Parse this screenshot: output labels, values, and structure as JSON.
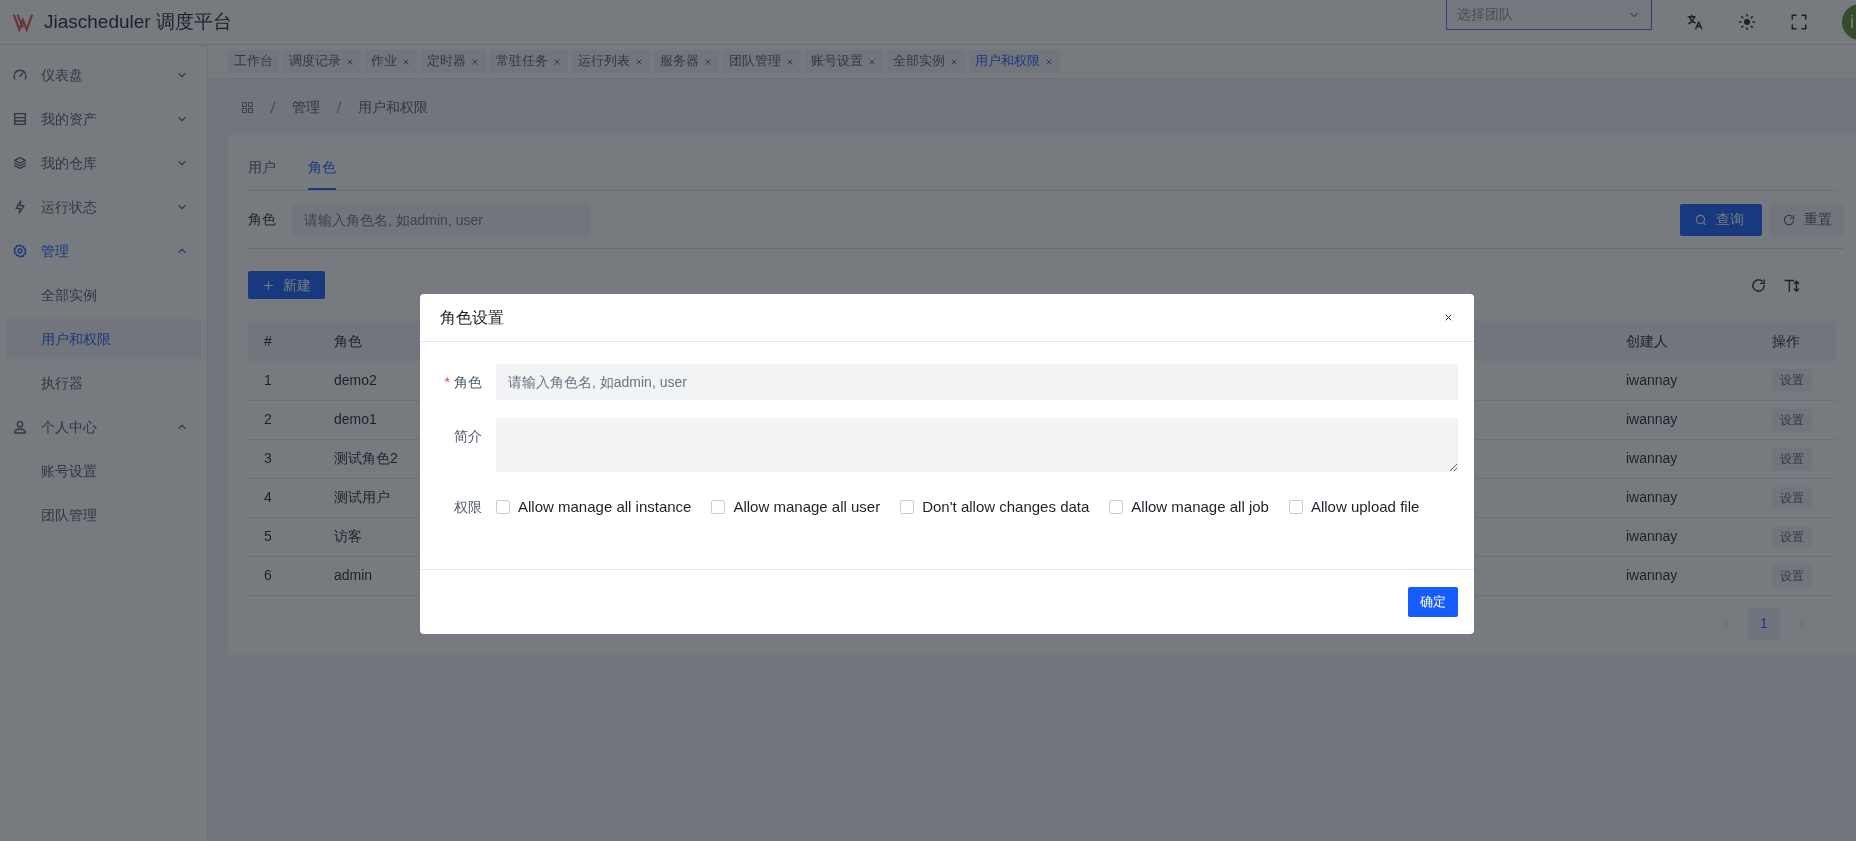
{
  "app": {
    "title": "Jiascheduler 调度平台"
  },
  "header": {
    "team_select": {
      "placeholder": "选择团队"
    },
    "avatar": "i"
  },
  "sidebar": {
    "items": [
      {
        "label": "仪表盘",
        "expanded": false,
        "selected": false
      },
      {
        "label": "我的资产",
        "expanded": false,
        "selected": false
      },
      {
        "label": "我的仓库",
        "expanded": false,
        "selected": false
      },
      {
        "label": "运行状态",
        "expanded": false,
        "selected": false
      },
      {
        "label": "管理",
        "expanded": true,
        "selected": true,
        "children": [
          {
            "label": "全部实例",
            "selected": false
          },
          {
            "label": "用户和权限",
            "selected": true
          },
          {
            "label": "执行器",
            "selected": false
          }
        ]
      },
      {
        "label": "个人中心",
        "expanded": true,
        "selected": false,
        "children": [
          {
            "label": "账号设置",
            "selected": false
          },
          {
            "label": "团队管理",
            "selected": false
          }
        ]
      }
    ]
  },
  "open_tabs": [
    {
      "label": "工作台",
      "closable": false,
      "selected": false
    },
    {
      "label": "调度记录",
      "closable": true,
      "selected": false
    },
    {
      "label": "作业",
      "closable": true,
      "selected": false
    },
    {
      "label": "定时器",
      "closable": true,
      "selected": false
    },
    {
      "label": "常驻任务",
      "closable": true,
      "selected": false
    },
    {
      "label": "运行列表",
      "closable": true,
      "selected": false
    },
    {
      "label": "服务器",
      "closable": true,
      "selected": false
    },
    {
      "label": "团队管理",
      "closable": true,
      "selected": false
    },
    {
      "label": "账号设置",
      "closable": true,
      "selected": false
    },
    {
      "label": "全部实例",
      "closable": true,
      "selected": false
    },
    {
      "label": "用户和权限",
      "closable": true,
      "selected": true
    }
  ],
  "breadcrumb": [
    "管理",
    "用户和权限"
  ],
  "page_tabs": [
    {
      "label": "用户",
      "selected": false
    },
    {
      "label": "角色",
      "selected": true
    }
  ],
  "filter": {
    "label": "角色",
    "placeholder": "请输入角色名, 如admin, user",
    "query": "查询",
    "reset": "重置"
  },
  "create_button": "新建",
  "table": {
    "columns": [
      "#",
      "角色",
      "创建人",
      "操作"
    ],
    "rows": [
      {
        "index": "1",
        "name": "demo2",
        "creator": "iwannay",
        "action": "设置"
      },
      {
        "index": "2",
        "name": "demo1",
        "creator": "iwannay",
        "action": "设置"
      },
      {
        "index": "3",
        "name": "测试角色2",
        "creator": "iwannay",
        "action": "设置"
      },
      {
        "index": "4",
        "name": "测试用户",
        "creator": "iwannay",
        "action": "设置"
      },
      {
        "index": "5",
        "name": "访客",
        "creator": "iwannay",
        "action": "设置"
      },
      {
        "index": "6",
        "name": "admin",
        "creator": "iwannay",
        "action": "设置"
      }
    ]
  },
  "pagination": {
    "pages": [
      {
        "label": "1",
        "selected": true
      }
    ]
  },
  "dialog": {
    "title": "角色设置",
    "fields": [
      {
        "kind": "input",
        "label": "角色",
        "required_mark": "*",
        "placeholder": "请输入角色名, 如admin, user"
      },
      {
        "kind": "textarea",
        "label": "简介"
      },
      {
        "kind": "checkboxes",
        "label": "权限",
        "options": [
          {
            "label": "Allow manage all instance",
            "checked": false
          },
          {
            "label": "Allow manage all user",
            "checked": false
          },
          {
            "label": "Don't allow changes data",
            "checked": false
          },
          {
            "label": "Allow manage all job",
            "checked": false
          },
          {
            "label": "Allow upload file",
            "checked": false
          }
        ]
      }
    ],
    "confirm": "确定"
  }
}
